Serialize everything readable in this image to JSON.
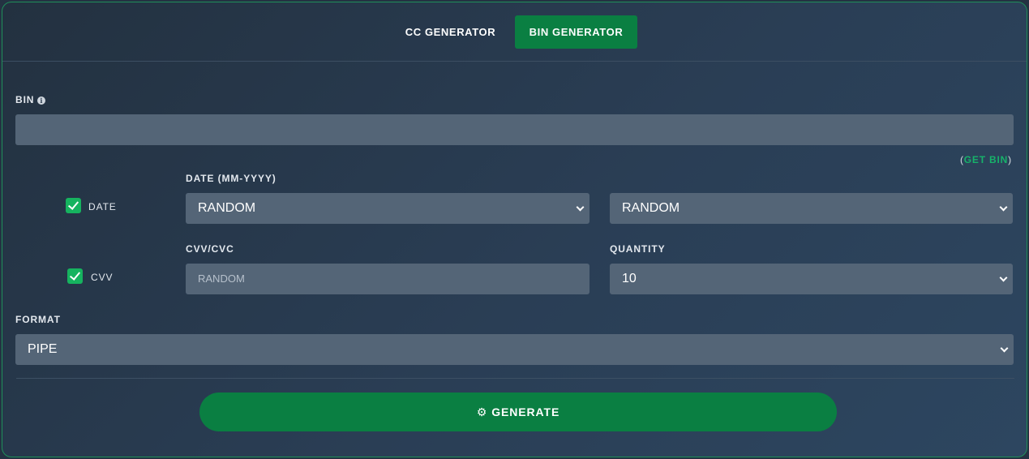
{
  "tabs": [
    {
      "label": "CC GENERATOR",
      "active": false
    },
    {
      "label": "BIN GENERATOR",
      "active": true
    }
  ],
  "bin": {
    "label": "BIN",
    "info_icon": "info-circle-icon",
    "value": "",
    "get_bin_open": "(",
    "get_bin_link": "GET BIN",
    "get_bin_close": ")"
  },
  "date": {
    "checkbox_label": "DATE",
    "checked": true,
    "label": "DATE (MM-YYYY)",
    "month_value": "RANDOM",
    "year_value": "RANDOM"
  },
  "cvv": {
    "checkbox_label": "CVV",
    "checked": true,
    "label": "CVV/CVC",
    "placeholder": "RANDOM"
  },
  "quantity": {
    "label": "QUANTITY",
    "value": "10"
  },
  "format": {
    "label": "FORMAT",
    "value": "PIPE"
  },
  "generate": {
    "icon": "gear-icon",
    "label": "GENERATE"
  },
  "colors": {
    "accent": "#0a7f42",
    "checkbox": "#16b35f",
    "link": "#17b26a",
    "field_bg": "#546577"
  }
}
